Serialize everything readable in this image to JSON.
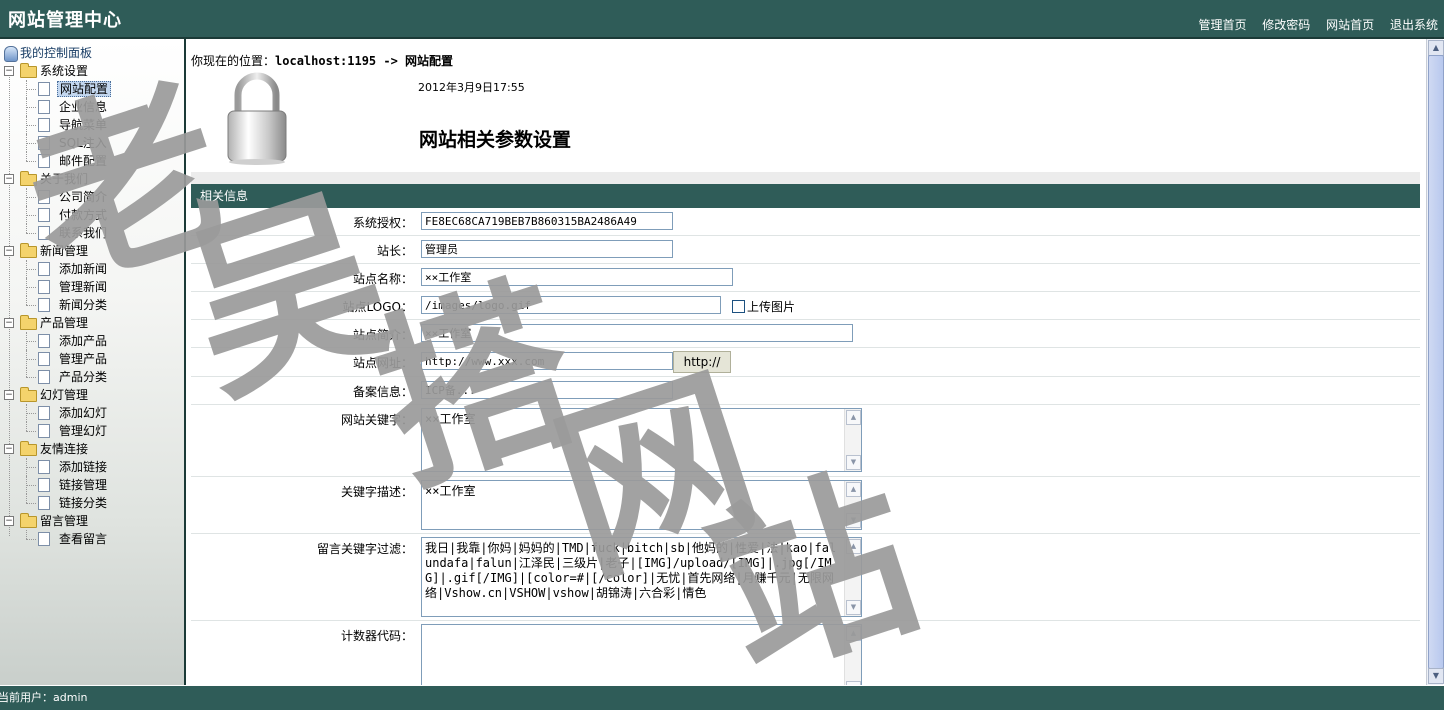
{
  "header": {
    "title": "网站管理中心",
    "nav": [
      "管理首页",
      "修改密码",
      "网站首页",
      "退出系统"
    ]
  },
  "sidebar": {
    "root": "我的控制面板",
    "groups": [
      {
        "label": "系统设置",
        "items": [
          "网站配置",
          "企业信息",
          "导航菜单",
          "SQL注入",
          "邮件配置"
        ]
      },
      {
        "label": "关于我们",
        "items": [
          "公司简介",
          "付款方式",
          "联系我们"
        ]
      },
      {
        "label": "新闻管理",
        "items": [
          "添加新闻",
          "管理新闻",
          "新闻分类"
        ]
      },
      {
        "label": "产品管理",
        "items": [
          "添加产品",
          "管理产品",
          "产品分类"
        ]
      },
      {
        "label": "幻灯管理",
        "items": [
          "添加幻灯",
          "管理幻灯"
        ]
      },
      {
        "label": "友情连接",
        "items": [
          "添加链接",
          "链接管理",
          "链接分类"
        ]
      },
      {
        "label": "留言管理",
        "items": [
          "查看留言"
        ]
      }
    ],
    "selected": "网站配置"
  },
  "location": {
    "prefix": "你现在的位置：",
    "path": "localhost:1195 -> 网站配置"
  },
  "page": {
    "date": "2012年3月9日17:55",
    "title": "网站相关参数设置",
    "section": "相关信息"
  },
  "form": {
    "license_label": "系统授权：",
    "license_value": "FE8EC68CA719BEB7B860315BA2486A49",
    "owner_label": "站长：",
    "owner_value": "管理员",
    "sitename_label": "站点名称：",
    "sitename_value": "××工作室",
    "logo_label": "站点LOGO：",
    "logo_value": "/images/logo.gif",
    "upload_label": "上传图片",
    "intro_label": "站点简介：",
    "intro_value": "××工作室",
    "url_label": "站点网址：",
    "url_value": "http://www.xxx.com",
    "url_button": "http://",
    "icp_label": "备案信息：",
    "icp_value": "ICP备...",
    "keywords_label": "网站关键字：",
    "keywords_value": "××工作室",
    "desc_label": "关键字描述：",
    "desc_value": "××工作室",
    "filter_label": "留言关键字过滤：",
    "filter_value": "我日|我靠|你妈|妈妈的|TMD|fuck|bitch|sb|他妈的|性爱|法|kao|falundafa|falun|江泽民|三级片|老子|[IMG]/upload/[IMG]|.jpg[/IMG]|.gif[/IMG]|[color=#|[/color]|无忧|首先网络|月赚千元|无限网络|Vshow.cn|VSHOW|vshow|胡锦涛|六合彩|情色",
    "counter_label": "计数器代码：",
    "counter_value": ""
  },
  "footer": {
    "user": "当前用户：admin"
  },
  "watermark": {
    "text": "老吴搭网站",
    "color": "#9a9a9a"
  }
}
